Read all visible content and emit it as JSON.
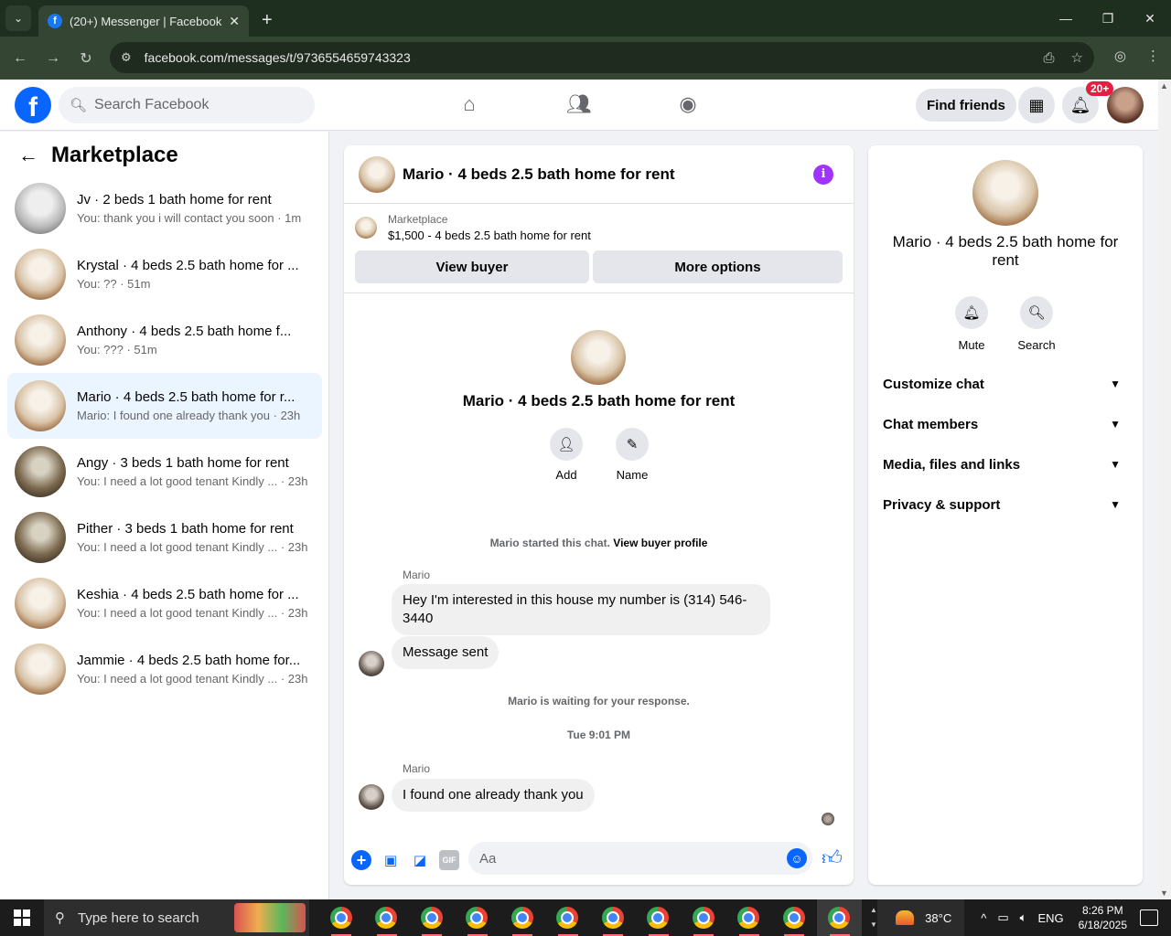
{
  "browser": {
    "tab_title": "(20+) Messenger | Facebook",
    "tab_close": "✕",
    "new_tab": "+",
    "url": "facebook.com/messages/t/9736554659743323"
  },
  "fb": {
    "search_placeholder": "Search Facebook",
    "find_friends": "Find friends",
    "notif_badge": "20+"
  },
  "sidebar": {
    "title": "Marketplace",
    "conversations": [
      {
        "name": "Jv · 2 beds 1 bath home for rent",
        "sub": "You: thank you i will contact you soon · 1m",
        "thumb": "room2"
      },
      {
        "name": "Krystal · 4 beds 2.5 bath home for ...",
        "sub": "You: ?? · 51m",
        "thumb": "room"
      },
      {
        "name": "Anthony · 4 beds 2.5 bath home f...",
        "sub": "You: ??? · 51m",
        "thumb": "room"
      },
      {
        "name": "Mario · 4 beds 2.5 bath home for r...",
        "sub": "Mario: I found one already thank you · 23h",
        "thumb": "room",
        "active": true
      },
      {
        "name": "Angy · 3 beds 1 bath home for rent",
        "sub": "You: I need a lot good tenant Kindly ... · 23h",
        "thumb": "dark"
      },
      {
        "name": "Pither · 3 beds 1 bath home for rent",
        "sub": "You: I need a lot good tenant Kindly ... · 23h",
        "thumb": "dark"
      },
      {
        "name": "Keshia · 4 beds 2.5 bath home for ...",
        "sub": "You: I need a lot good tenant Kindly ... · 23h",
        "thumb": "room"
      },
      {
        "name": "Jammie · 4 beds 2.5 bath home for...",
        "sub": "You: I need a lot good tenant Kindly ... · 23h",
        "thumb": "room"
      }
    ]
  },
  "chat": {
    "title": "Mario · 4 beds 2.5 bath home for rent",
    "marketplace_label": "Marketplace",
    "listing": "$1,500 - 4 beds 2.5 bath home for rent",
    "view_buyer": "View buyer",
    "more_options": "More options",
    "intro_name": "Mario · 4 beds 2.5 bath home for rent",
    "add_label": "Add",
    "name_label": "Name",
    "started_text": "Mario started this chat.",
    "view_buyer_profile": "View buyer profile",
    "sender1": "Mario",
    "msg1": "Hey I'm interested in this house my number is (314) 546-3440",
    "msg2": "Message sent",
    "waiting": "Mario is waiting for your response.",
    "timestamp": "Tue 9:01 PM",
    "sender2": "Mario",
    "msg3": "I found one already thank you",
    "input_placeholder": "Aa",
    "gif": "GIF"
  },
  "info": {
    "name": "Mario · 4 beds 2.5 bath home for rent",
    "mute": "Mute",
    "search": "Search",
    "sections": [
      "Customize chat",
      "Chat members",
      "Media, files and links",
      "Privacy & support"
    ]
  },
  "taskbar": {
    "search_placeholder": "Type here to search",
    "temperature": "38°C",
    "lang": "ENG",
    "time": "8:26 PM",
    "date": "6/18/2025"
  }
}
